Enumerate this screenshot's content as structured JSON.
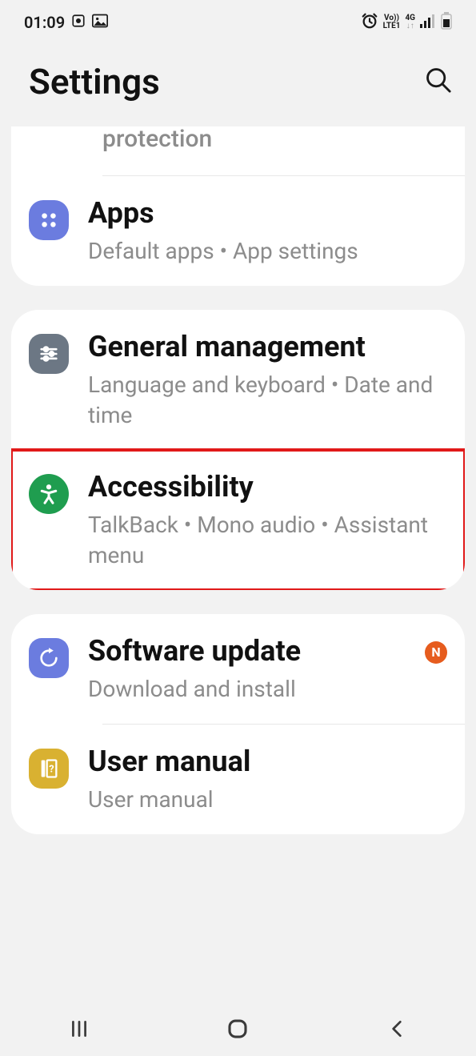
{
  "status": {
    "time": "01:09",
    "network_label_top": "Vo))",
    "network_label_bottom": "LTE1",
    "network_gen": "4G"
  },
  "header": {
    "title": "Settings"
  },
  "partial_item": "protection",
  "items": {
    "apps": {
      "title": "Apps",
      "subtitle": "Default apps  •  App settings"
    },
    "general": {
      "title": "General management",
      "subtitle": "Language and keyboard  •  Date and time"
    },
    "accessibility": {
      "title": "Accessibility",
      "subtitle": "TalkBack  •  Mono audio  •  Assistant menu"
    },
    "software": {
      "title": "Software update",
      "subtitle": "Download and install",
      "badge": "N"
    },
    "manual": {
      "title": "User manual",
      "subtitle": "User manual"
    }
  }
}
